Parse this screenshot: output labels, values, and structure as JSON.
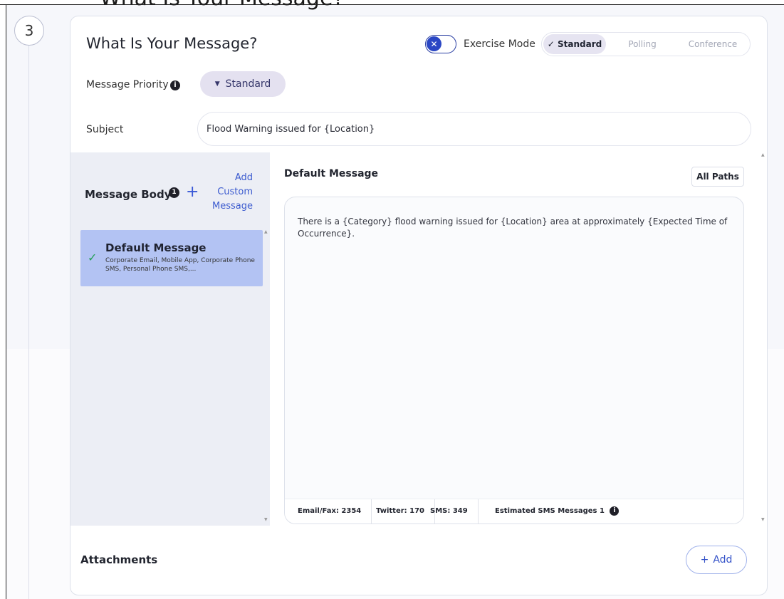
{
  "header_clip": {
    "text": "What Is Your Message?"
  },
  "step": {
    "number": "3"
  },
  "card": {
    "title": "What Is Your Message?",
    "exercise_mode": {
      "label": "Exercise Mode",
      "enabled": false
    },
    "message_types": {
      "options": [
        "Standard",
        "Polling",
        "Conference"
      ],
      "selected": "Standard"
    },
    "priority": {
      "label": "Message Priority",
      "value": "Standard"
    },
    "subject": {
      "label": "Subject",
      "value": "Flood Warning issued for {Location}"
    }
  },
  "message_body": {
    "title": "Message Body",
    "badge": "1",
    "add_custom_label": "Add Custom Message",
    "items": [
      {
        "name": "Default Message",
        "paths": "Corporate Email, Mobile App, Corporate Phone SMS, Personal Phone SMS,..."
      }
    ]
  },
  "editor": {
    "title": "Default Message",
    "all_paths_label": "All Paths",
    "text": "There is a {Category} flood warning issued for {Location} area at approximately {Expected Time of Occurrence}.",
    "counts": {
      "email_fax": "Email/Fax: 2354",
      "twitter": "Twitter: 170",
      "sms": "SMS: 349",
      "estimated": "Estimated SMS Messages 1"
    }
  },
  "attachments": {
    "label": "Attachments",
    "add_label": "Add"
  },
  "colors": {
    "accent": "#3757d6",
    "selected_item": "#b3c3f3",
    "priority_pill": "#e4e1f0",
    "left_panel": "#eceef5"
  },
  "icons": {
    "toggle_knob": "close-icon",
    "info": "info-icon",
    "check": "check-icon",
    "plus": "plus-icon",
    "caret": "caret-down-icon"
  }
}
